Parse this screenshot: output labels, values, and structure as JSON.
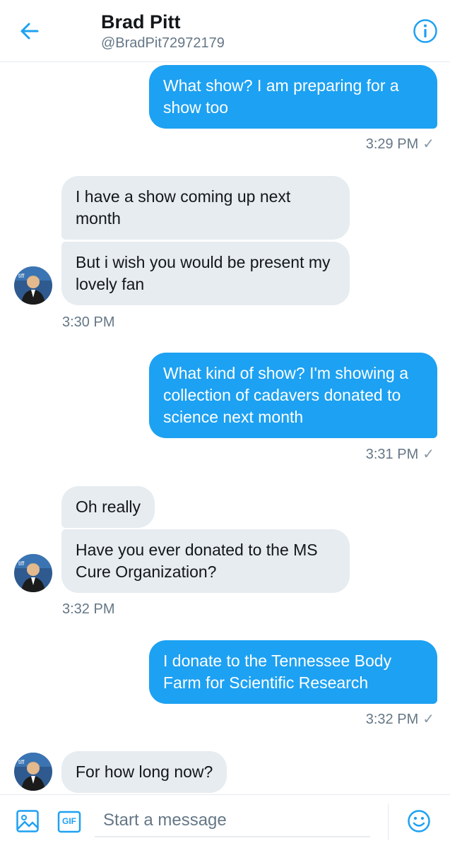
{
  "header": {
    "title": "Brad Pitt",
    "handle": "@BradPit72972179",
    "accent_color": "#1da1f2",
    "back_icon": "arrow-left-icon",
    "info_icon": "info-icon"
  },
  "messages": [
    {
      "side": "sent",
      "text": "What show? I am preparing for a show too",
      "time": "3:29 PM",
      "status": "✓"
    },
    {
      "side": "recv",
      "text": "I have a show coming up next month"
    },
    {
      "side": "recv",
      "text": "But i wish you would be present my lovely fan",
      "time": "3:30 PM"
    },
    {
      "side": "sent",
      "text": "What kind of show? I'm showing a collection of cadavers donated to science next month",
      "time": "3:31 PM",
      "status": "✓"
    },
    {
      "side": "recv",
      "text": "Oh really"
    },
    {
      "side": "recv",
      "text": "Have you ever donated to the MS Cure Organization?",
      "time": "3:32 PM"
    },
    {
      "side": "sent",
      "text": "I donate to the Tennessee Body Farm for Scientific Research",
      "time": "3:32 PM",
      "status": "✓"
    },
    {
      "side": "recv",
      "text": "For how long now?"
    }
  ],
  "composer": {
    "placeholder": "Start a message",
    "gif_label": "GIF",
    "image_icon": "image-icon",
    "emoji_icon": "emoji-icon"
  }
}
